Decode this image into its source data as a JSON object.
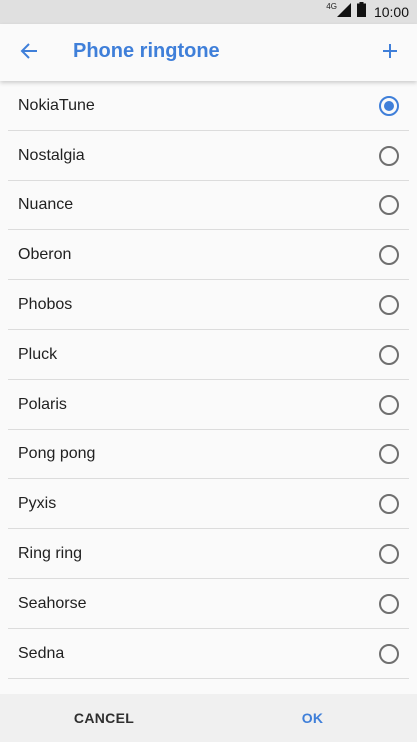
{
  "status_bar": {
    "network": "4G",
    "time": "10:00"
  },
  "header": {
    "title": "Phone ringtone",
    "back_icon": "arrow-back-icon",
    "add_icon": "plus-icon"
  },
  "ringtones": [
    {
      "label": "NokiaTune",
      "selected": true
    },
    {
      "label": "Nostalgia",
      "selected": false
    },
    {
      "label": "Nuance",
      "selected": false
    },
    {
      "label": "Oberon",
      "selected": false
    },
    {
      "label": "Phobos",
      "selected": false
    },
    {
      "label": "Pluck",
      "selected": false
    },
    {
      "label": "Polaris",
      "selected": false
    },
    {
      "label": "Pong pong",
      "selected": false
    },
    {
      "label": "Pyxis",
      "selected": false
    },
    {
      "label": "Ring ring",
      "selected": false
    },
    {
      "label": "Seahorse",
      "selected": false
    },
    {
      "label": "Sedna",
      "selected": false
    }
  ],
  "footer": {
    "cancel_label": "CANCEL",
    "ok_label": "OK"
  },
  "colors": {
    "accent": "#3f7fd9",
    "status_bar_bg": "#e0e0e0",
    "background": "#fafafa"
  }
}
